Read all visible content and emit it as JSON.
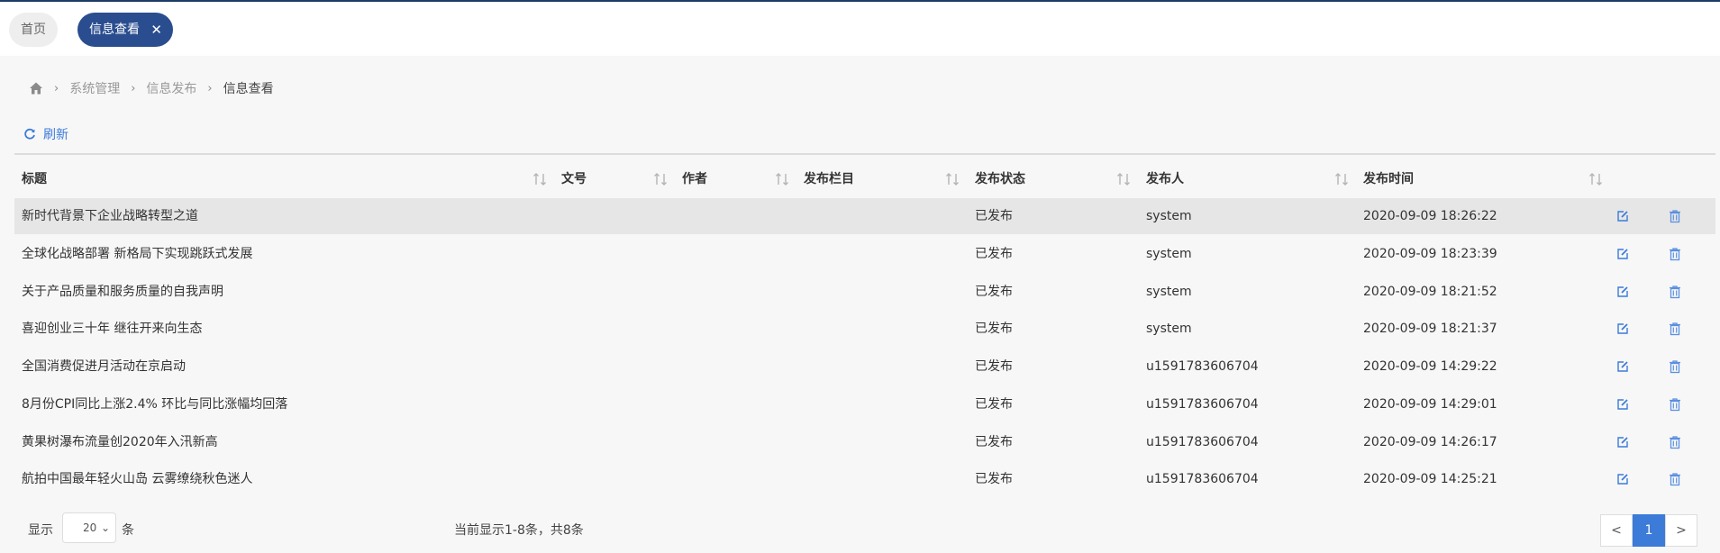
{
  "tabs": {
    "home_label": "首页",
    "active_label": "信息查看"
  },
  "breadcrumb": {
    "items": [
      "系统管理",
      "信息发布"
    ],
    "current": "信息查看"
  },
  "toolbar": {
    "refresh_label": "刷新"
  },
  "table": {
    "columns": [
      "标题",
      "文号",
      "作者",
      "发布栏目",
      "发布状态",
      "发布人",
      "发布时间"
    ],
    "rows": [
      {
        "title": "新时代背景下企业战略转型之道",
        "doc_no": "",
        "author": "",
        "column": "",
        "status": "已发布",
        "publisher": "system",
        "time": "2020-09-09 18:26:22"
      },
      {
        "title": "全球化战略部署 新格局下实现跳跃式发展",
        "doc_no": "",
        "author": "",
        "column": "",
        "status": "已发布",
        "publisher": "system",
        "time": "2020-09-09 18:23:39"
      },
      {
        "title": "关于产品质量和服务质量的自我声明",
        "doc_no": "",
        "author": "",
        "column": "",
        "status": "已发布",
        "publisher": "system",
        "time": "2020-09-09 18:21:52"
      },
      {
        "title": "喜迎创业三十年 继往开来向生态",
        "doc_no": "",
        "author": "",
        "column": "",
        "status": "已发布",
        "publisher": "system",
        "time": "2020-09-09 18:21:37"
      },
      {
        "title": "全国消费促进月活动在京启动",
        "doc_no": "",
        "author": "",
        "column": "",
        "status": "已发布",
        "publisher": "u1591783606704",
        "time": "2020-09-09 14:29:22"
      },
      {
        "title": "8月份CPI同比上涨2.4% 环比与同比涨幅均回落",
        "doc_no": "",
        "author": "",
        "column": "",
        "status": "已发布",
        "publisher": "u1591783606704",
        "time": "2020-09-09 14:29:01"
      },
      {
        "title": "黄果树瀑布流量创2020年入汛新高",
        "doc_no": "",
        "author": "",
        "column": "",
        "status": "已发布",
        "publisher": "u1591783606704",
        "time": "2020-09-09 14:26:17"
      },
      {
        "title": "航拍中国最年轻火山岛 云雾缭绕秋色迷人",
        "doc_no": "",
        "author": "",
        "column": "",
        "status": "已发布",
        "publisher": "u1591783606704",
        "time": "2020-09-09 14:25:21"
      }
    ]
  },
  "footer": {
    "show_label": "显示",
    "page_size": "20",
    "unit_label": "条",
    "summary": "当前显示1-8条，共8条",
    "prev": "<",
    "page": "1",
    "next": ">"
  },
  "colors": {
    "accent": "#3c7bd8",
    "active_tab": "#2a4d8f",
    "delete_icon": "#5b8fe0"
  }
}
